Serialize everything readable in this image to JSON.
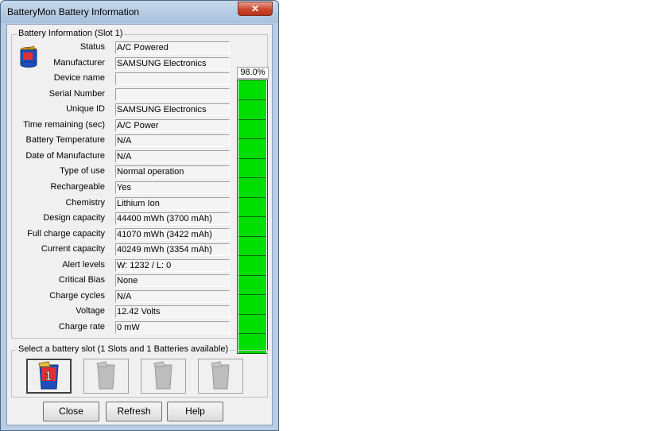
{
  "window": {
    "title": "BatteryMon Battery Information",
    "close_label": "✕"
  },
  "info_group": {
    "label": "Battery Information (Slot 1)",
    "rows": [
      {
        "label": "Status",
        "value": "A/C Powered"
      },
      {
        "label": "Manufacturer",
        "value": "SAMSUNG Electronics"
      },
      {
        "label": "Device name",
        "value": ""
      },
      {
        "label": "Serial Number",
        "value": ""
      },
      {
        "label": "Unique ID",
        "value": "SAMSUNG Electronics"
      },
      {
        "label": "Time remaining (sec)",
        "value": "A/C Power"
      },
      {
        "label": "Battery Temperature",
        "value": "N/A"
      },
      {
        "label": "Date of Manufacture",
        "value": "N/A"
      },
      {
        "label": "Type of use",
        "value": "Normal operation"
      },
      {
        "label": "Rechargeable",
        "value": "Yes"
      },
      {
        "label": "Chemistry",
        "value": "Lithium Ion"
      },
      {
        "label": "Design capacity",
        "value": "44400 mWh (3700 mAh)"
      },
      {
        "label": "Full charge capacity",
        "value": "41070 mWh (3422 mAh)"
      },
      {
        "label": "Current capacity",
        "value": "40249 mWh (3354 mAh)"
      },
      {
        "label": "Alert levels",
        "value": "W: 1232 / L: 0"
      },
      {
        "label": "Critical Bias",
        "value": "None"
      },
      {
        "label": "Charge cycles",
        "value": "N/A"
      },
      {
        "label": "Voltage",
        "value": "12.42 Volts"
      },
      {
        "label": "Charge rate",
        "value": "0 mW"
      }
    ],
    "charge_percent_text": "98.0%",
    "charge_fraction": 0.98,
    "bar_color": "#00dd00"
  },
  "slot_group": {
    "label": "Select a battery slot (1 Slots and 1 Batteries available)",
    "slots": [
      {
        "name": "slot-1",
        "icon": "battery-slot-1-icon",
        "active": true,
        "number": "1"
      },
      {
        "name": "slot-2",
        "icon": "battery-empty-icon",
        "active": false
      },
      {
        "name": "slot-3",
        "icon": "battery-empty-icon",
        "active": false
      },
      {
        "name": "slot-4",
        "icon": "battery-empty-icon",
        "active": false
      }
    ]
  },
  "buttons": {
    "close": "Close",
    "refresh": "Refresh",
    "help": "Help"
  }
}
